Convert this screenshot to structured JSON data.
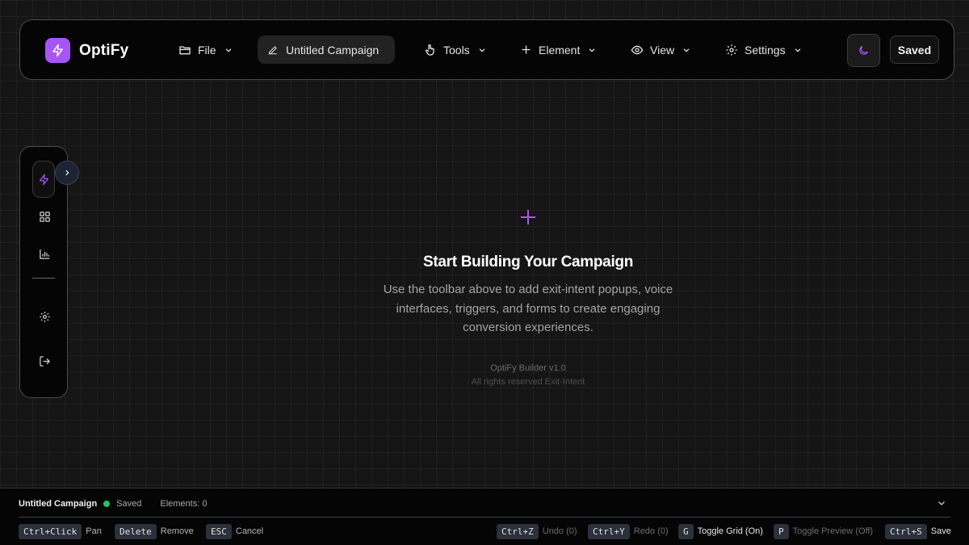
{
  "brand": {
    "name": "OptiFy"
  },
  "toolbar": {
    "menus": {
      "file": "File",
      "tools": "Tools",
      "element": "Element",
      "view": "View",
      "settings": "Settings"
    },
    "campaign_name": "Untitled Campaign",
    "save_status": "Saved",
    "icons": [
      "folder-icon",
      "pencil-icon",
      "pointer-hand-icon",
      "plus-icon",
      "eye-icon",
      "gear-icon",
      "moon-icon"
    ]
  },
  "sidebar": {
    "items": [
      "lightning-icon",
      "grid-icon",
      "bar-chart-icon",
      "gear-icon",
      "logout-icon"
    ]
  },
  "empty_state": {
    "title": "Start Building Your Campaign",
    "description": "Use the toolbar above to add exit-intent popups, voice interfaces, triggers, and forms to create engaging conversion experiences.",
    "version": "OptiFy Builder v1.0",
    "rights": "All rights reserved Exit-Intent"
  },
  "statusbar": {
    "campaign_name": "Untitled Campaign",
    "save_status": "Saved",
    "elements": "Elements: 0"
  },
  "shortcuts": {
    "pan": {
      "key": "Ctrl+Click",
      "label": "Pan"
    },
    "remove": {
      "key": "Delete",
      "label": "Remove"
    },
    "cancel": {
      "key": "ESC",
      "label": "Cancel"
    },
    "undo": {
      "key": "Ctrl+Z",
      "label": "Undo (0)"
    },
    "redo": {
      "key": "Ctrl+Y",
      "label": "Redo (0)"
    },
    "grid": {
      "key": "G",
      "label": "Toggle Grid (On)"
    },
    "preview": {
      "key": "P",
      "label": "Toggle Preview (Off)"
    },
    "save": {
      "key": "Ctrl+S",
      "label": "Save"
    }
  },
  "colors": {
    "accent": "#a855f7",
    "status_green": "#22c55e",
    "background": "#151515"
  }
}
